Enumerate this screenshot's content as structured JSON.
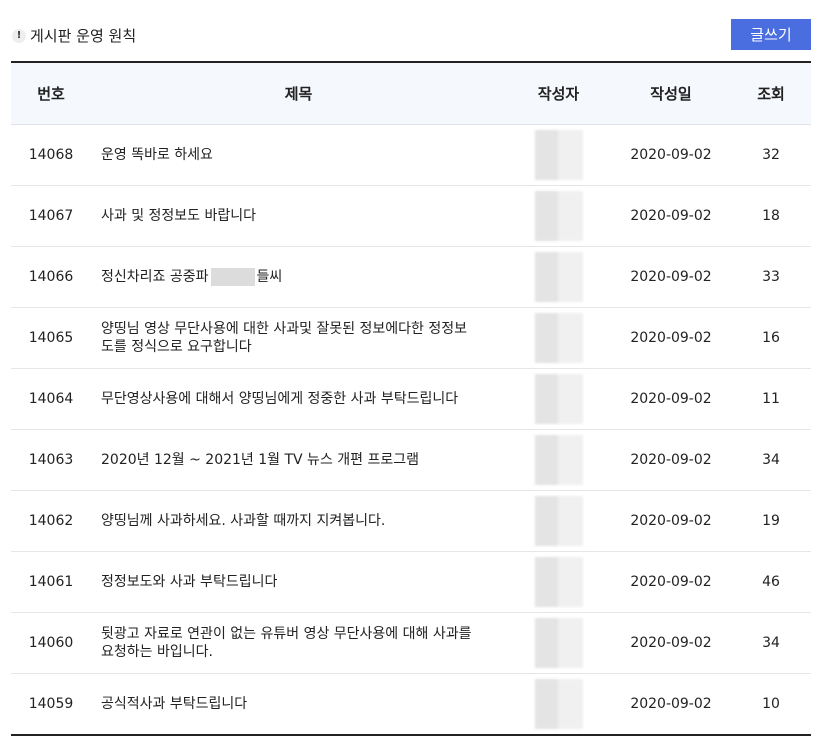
{
  "header": {
    "rules_label": "게시판 운영 원칙",
    "rules_icon": "info-icon",
    "write_label": "글쓰기",
    "accent_color": "#4a6ee0"
  },
  "table": {
    "columns": {
      "num": "번호",
      "title": "제목",
      "author": "작성자",
      "date": "작성일",
      "views": "조회"
    },
    "rows": [
      {
        "num": "14068",
        "title": "운영 똑바로 하세요",
        "date": "2020-09-02",
        "views": "32"
      },
      {
        "num": "14067",
        "title": "사과 및 정정보도 바랍니다",
        "date": "2020-09-02",
        "views": "18"
      },
      {
        "num": "14066",
        "title_before": "정신차리죠 공중파",
        "title_after": "들씨",
        "date": "2020-09-02",
        "views": "33"
      },
      {
        "num": "14065",
        "title": "양띵님 영상 무단사용에 대한 사과및 잘못된 정보에다한 정정보도를 정식으로 요구합니다",
        "date": "2020-09-02",
        "views": "16"
      },
      {
        "num": "14064",
        "title": "무단영상사용에 대해서 양띵님에게 정중한 사과 부탁드립니다",
        "date": "2020-09-02",
        "views": "11"
      },
      {
        "num": "14063",
        "title": "2020년 12월 ~ 2021년 1월 TV 뉴스 개편 프로그램",
        "date": "2020-09-02",
        "views": "34"
      },
      {
        "num": "14062",
        "title": "양띵님께 사과하세요. 사과할 때까지 지켜봅니다.",
        "date": "2020-09-02",
        "views": "19"
      },
      {
        "num": "14061",
        "title": "정정보도와 사과 부탁드립니다",
        "date": "2020-09-02",
        "views": "46"
      },
      {
        "num": "14060",
        "title": "뒷광고 자료로 연관이 없는 유튜버 영상 무단사용에 대해 사과를 요청하는 바입니다.",
        "date": "2020-09-02",
        "views": "34"
      },
      {
        "num": "14059",
        "title": "공식적사과 부탁드립니다",
        "date": "2020-09-02",
        "views": "10"
      }
    ]
  }
}
